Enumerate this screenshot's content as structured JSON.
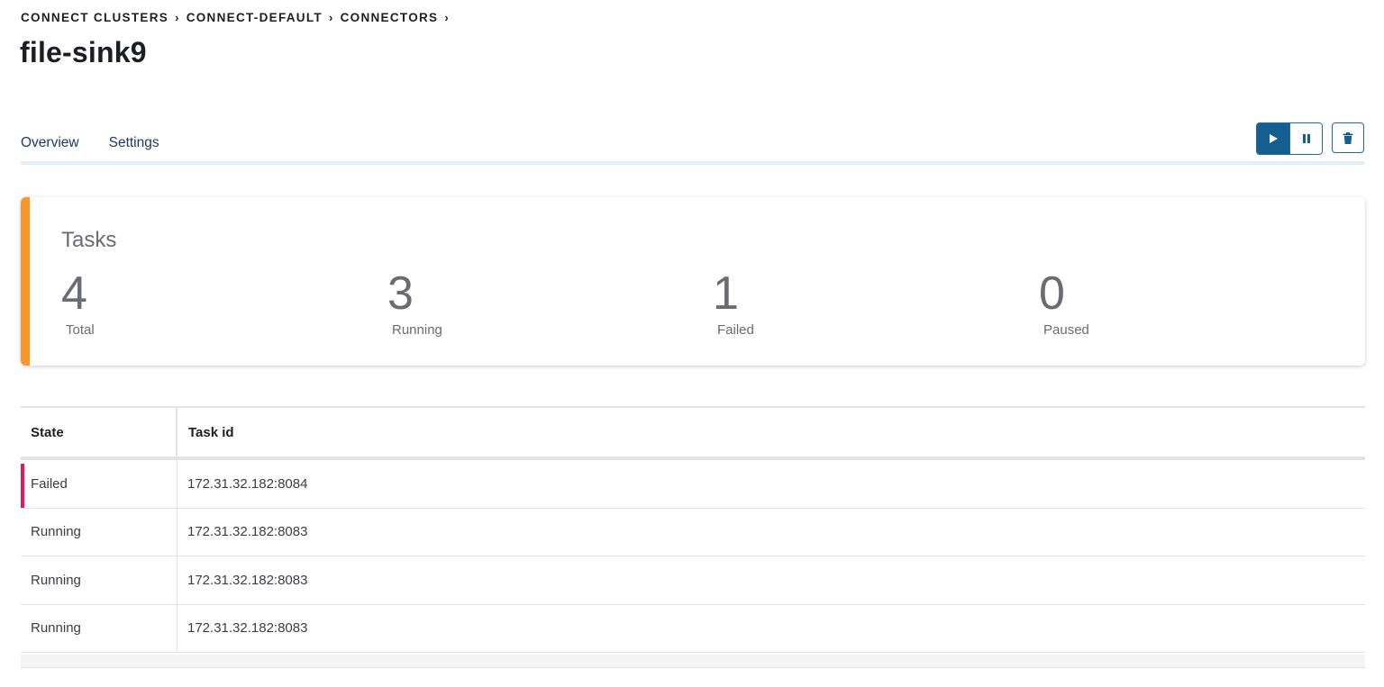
{
  "breadcrumb": [
    {
      "label": "CONNECT CLUSTERS"
    },
    {
      "label": "CONNECT-DEFAULT"
    },
    {
      "label": "CONNECTORS"
    }
  ],
  "page_title": "file-sink9",
  "tabs": [
    {
      "label": "Overview",
      "active": true
    },
    {
      "label": "Settings",
      "active": false
    }
  ],
  "actions": {
    "play_icon": "play-icon",
    "pause_icon": "pause-icon",
    "delete_icon": "trash-icon"
  },
  "tasks_card": {
    "title": "Tasks",
    "accent_color": "#f7962b",
    "stats": [
      {
        "value": "4",
        "label": "Total"
      },
      {
        "value": "3",
        "label": "Running"
      },
      {
        "value": "1",
        "label": "Failed"
      },
      {
        "value": "0",
        "label": "Paused"
      }
    ]
  },
  "table": {
    "columns": [
      "State",
      "Task id"
    ],
    "rows": [
      {
        "state": "Failed",
        "task_id": "172.31.32.182:8084",
        "status_color": "#e8175d"
      },
      {
        "state": "Running",
        "task_id": "172.31.32.182:8083"
      },
      {
        "state": "Running",
        "task_id": "172.31.32.182:8083"
      },
      {
        "state": "Running",
        "task_id": "172.31.32.182:8083"
      }
    ]
  }
}
